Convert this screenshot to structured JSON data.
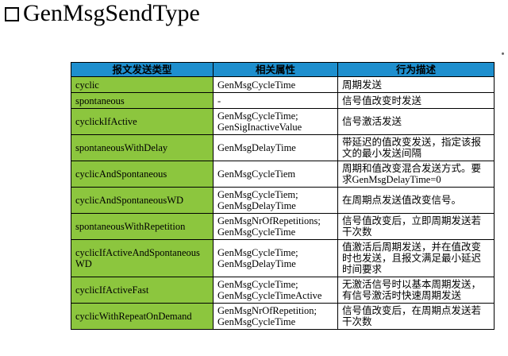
{
  "page": {
    "title": "GenMsgSendType"
  },
  "table": {
    "headers": [
      "报文发送类型",
      "相关属性",
      "行为描述"
    ],
    "rows": [
      {
        "type": "cyclic",
        "attrs": "GenMsgCycleTime",
        "desc": "周期发送"
      },
      {
        "type": "spontaneous",
        "attrs": "-",
        "desc": "信号值改变时发送"
      },
      {
        "type": "cyclickIfActive",
        "attrs": "GenMsgCycleTime;\nGenSigInactiveValue",
        "desc": "信号激活发送"
      },
      {
        "type": "spontaneousWithDelay",
        "attrs": "GenMsgDelayTime",
        "desc": "带延迟的值改变发送，指定该报文的最小发送间隔"
      },
      {
        "type": "cyclicAndSpontaneous",
        "attrs": "GenMsgCycleTiem",
        "desc": "周期和值改变混合发送方式。要求GenMsgDelayTime=0"
      },
      {
        "type": "cyclicAndSpontaneousWD",
        "attrs": "GenMsgCycleTiem;\nGenMsgDelayTime",
        "desc": "在周期点发送值改变信号。"
      },
      {
        "type": "spontaneousWithRepetition",
        "attrs": "GenMsgNrOfRepetitions;\nGenMsgCycleTime",
        "desc": "信号值改变后，立即周期发送若干次数"
      },
      {
        "type": "cyclicIfActiveAndSpontaneousWD",
        "attrs": "GenMsgCycleTime;\nGenMsgDelayTime",
        "desc": "值激活后周期发送，并在值改变时也发送，且报文满足最小延迟时间要求"
      },
      {
        "type": "cyclicIfActiveFast",
        "attrs": "GenMsgCycleTime;\nGenMsgCycleTimeActive",
        "desc": "无激活信号时以基本周期发送，有信号激活时快速周期发送"
      },
      {
        "type": "cyclicWithRepeatOnDemand",
        "attrs": "GenMsgNrOfRepetition;\nGenMsgCycleTime",
        "desc": "信号值改变后，在周期点发送若干次数"
      }
    ]
  }
}
